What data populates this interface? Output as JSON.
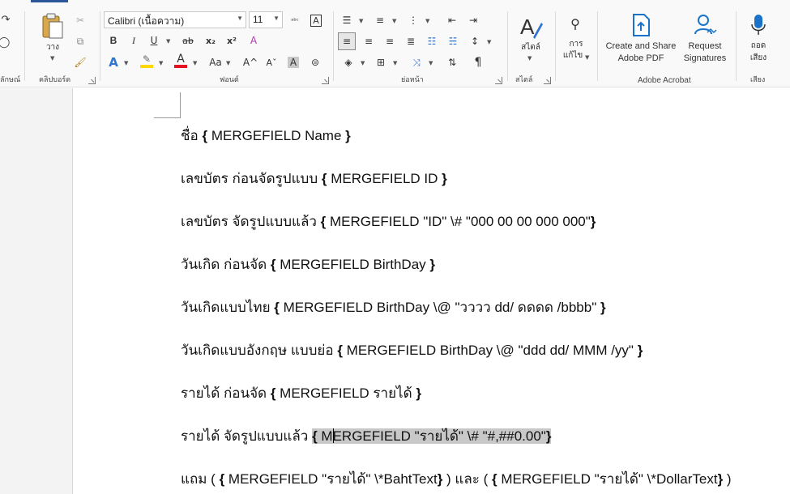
{
  "ribbon": {
    "clipboard": {
      "label": "คลิปบอร์ด",
      "paste_label": "วาง"
    },
    "font": {
      "label": "ฟอนต์",
      "font_name": "Calibri (เนื้อความ)",
      "font_size": "11",
      "bold": "B",
      "italic": "I",
      "underline": "U",
      "strike": "ab",
      "subscript": "x₂",
      "superscript": "x²",
      "text_effects": "A",
      "font_color": "A",
      "change_case": "Aa",
      "grow": "A^",
      "shrink": "Aˇ",
      "shading": "A",
      "phonetic": "ᵃᵇᶜ",
      "char_border": "A"
    },
    "paragraph": {
      "label": "ย่อหน้า",
      "pilcrow": "¶"
    },
    "styles": {
      "label": "สไตล์",
      "button": "สไตล์"
    },
    "editing": {
      "line1": "การ",
      "line2": "แก้ไข"
    },
    "acrobat": {
      "label": "Adobe Acrobat",
      "create_line1": "Create and Share",
      "create_line2": "Adobe PDF",
      "request_line1": "Request",
      "request_line2": "Signatures"
    },
    "voice": {
      "label": "เสียง",
      "dictate_line1": "ถอด",
      "dictate_line2": "เสียง"
    },
    "cut_left_label": "ลักษณ์"
  },
  "colors": {
    "accent": "#2b579a",
    "highlight": "#ffd800",
    "font_red": "#e81123",
    "acrobat_blue": "#1a73c9"
  },
  "document": {
    "lines": [
      {
        "text": "ชื่อ ",
        "field": " MERGEFIELD Name "
      },
      {
        "text": "เลขบัตร ก่อนจัดรูปแบบ ",
        "field": " MERGEFIELD ID "
      },
      {
        "text": "เลขบัตร จัดรูปแบบแล้ว ",
        "field": " MERGEFIELD \"ID\" \\# \"000 00 00 000 000\""
      },
      {
        "text": "วันเกิด ก่อนจัด ",
        "field": " MERGEFIELD BirthDay "
      },
      {
        "text": "วันเกิดแบบไทย ",
        "field": " MERGEFIELD BirthDay \\@ \"วววว dd/ ดดดด /bbbb\" "
      },
      {
        "text": "วันเกิดแบบอังกฤษ แบบย่อ ",
        "field": " MERGEFIELD BirthDay \\@ \"ddd dd/ MMM /yy\" "
      },
      {
        "text": "รายได้ ก่อนจัด ",
        "field": " MERGEFIELD รายได้ "
      },
      {
        "text": "รายได้ จัดรูปแบบแล้ว ",
        "field_a": " M",
        "field_b": "ERGEFIELD \"รายได้\" \\# \"#,##0.00\""
      },
      {
        "text": "แถม  ( ",
        "field": " MERGEFIELD \"รายได้\" \\*BahtText",
        "middle": " ) และ ( ",
        "field2": " MERGEFIELD \"รายได้\" \\*DollarText",
        "end": " )"
      }
    ]
  }
}
